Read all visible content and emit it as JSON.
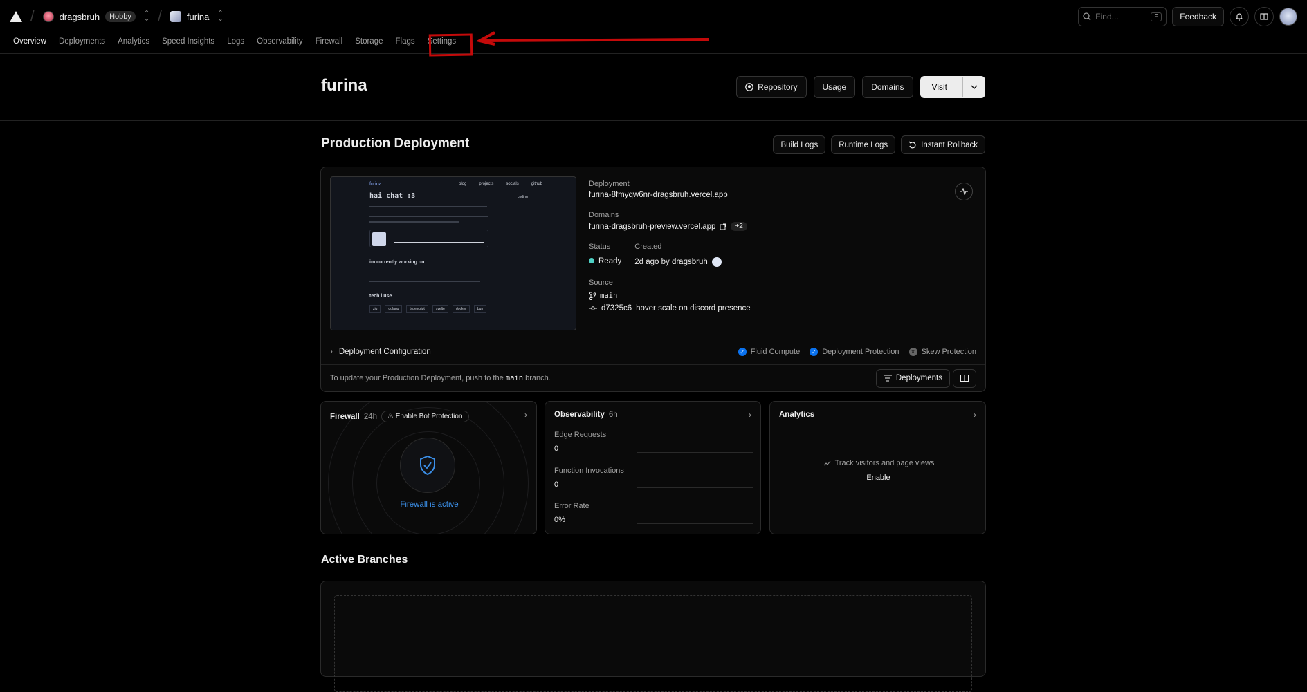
{
  "topbar": {
    "team": "dragsbruh",
    "plan_badge": "Hobby",
    "project": "furina",
    "search_placeholder": "Find...",
    "search_shortcut": "F",
    "feedback_label": "Feedback"
  },
  "tabs": [
    "Overview",
    "Deployments",
    "Analytics",
    "Speed Insights",
    "Logs",
    "Observability",
    "Firewall",
    "Storage",
    "Flags",
    "Settings"
  ],
  "header": {
    "title": "furina",
    "repository_label": "Repository",
    "usage_label": "Usage",
    "domains_label": "Domains",
    "visit_label": "Visit"
  },
  "production": {
    "title": "Production Deployment",
    "build_logs_label": "Build Logs",
    "runtime_logs_label": "Runtime Logs",
    "rollback_label": "Instant Rollback",
    "deployment_label": "Deployment",
    "deployment_url": "furina-8fmyqw6nr-dragsbruh.vercel.app",
    "domains_label": "Domains",
    "domain_url": "furina-dragsbruh-preview.vercel.app",
    "domain_more": "+2",
    "status_label": "Status",
    "status_value": "Ready",
    "created_label": "Created",
    "created_value": "2d ago by dragsbruh",
    "source_label": "Source",
    "branch": "main",
    "commit_hash": "d7325c6",
    "commit_message": "hover scale on discord presence",
    "config_label": "Deployment Configuration",
    "fluid_compute": "Fluid Compute",
    "deployment_protection": "Deployment Protection",
    "skew_protection": "Skew Protection",
    "update_hint_before": "To update your Production Deployment, push to the",
    "update_hint_branch": "main",
    "update_hint_after": "branch.",
    "deployments_button": "Deployments"
  },
  "preview": {
    "site_name": "furina",
    "nav": [
      "blog",
      "projects",
      "socials",
      "github"
    ],
    "heading": "hai chat :3",
    "status_tag": "coding",
    "working_on": "im currently working on:",
    "tech": "tech i use",
    "chips": [
      "zig",
      "golang",
      "typescript",
      "svelte",
      "docker",
      "bun"
    ]
  },
  "firewall": {
    "title": "Firewall",
    "period": "24h",
    "bot_protection_label": "Enable Bot Protection",
    "status_text": "Firewall is active"
  },
  "observability": {
    "title": "Observability",
    "period": "6h",
    "metrics": [
      {
        "label": "Edge Requests",
        "value": "0"
      },
      {
        "label": "Function Invocations",
        "value": "0"
      },
      {
        "label": "Error Rate",
        "value": "0%"
      }
    ]
  },
  "analytics": {
    "title": "Analytics",
    "cta_text": "Track visitors and page views",
    "enable_label": "Enable"
  },
  "branches": {
    "title": "Active Branches"
  },
  "colors": {
    "accent_blue": "#0a72ef",
    "ready_green": "#4fd1c5",
    "annotation_red": "#c40a0a"
  }
}
